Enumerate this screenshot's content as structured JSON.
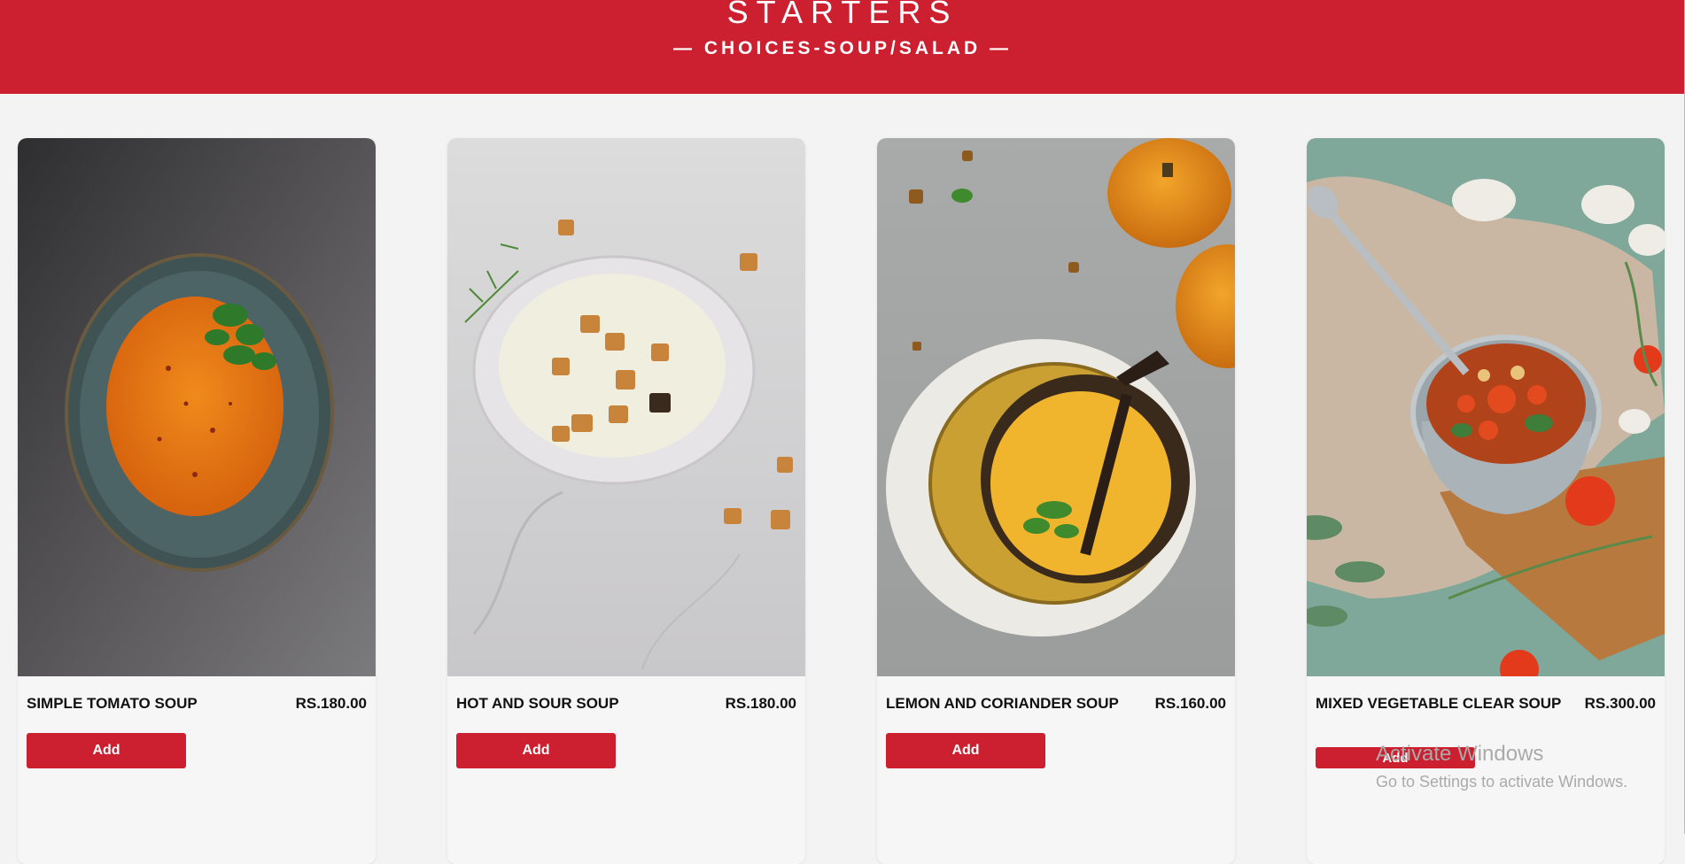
{
  "header": {
    "title": "STARTERS",
    "subtitle": "— CHOICES-SOUP/SALAD —"
  },
  "colors": {
    "brand_red": "#cc1f2f",
    "page_bg": "#f3f3f3",
    "card_bg": "#f6f6f6"
  },
  "items": [
    {
      "name": "SIMPLE TOMATO SOUP",
      "price": "RS.180.00",
      "add_label": "Add"
    },
    {
      "name": "HOT AND SOUR SOUP",
      "price": "RS.180.00",
      "add_label": "Add"
    },
    {
      "name": "LEMON AND CORIANDER SOUP",
      "price": "RS.160.00",
      "add_label": "Add"
    },
    {
      "name": "MIXED VEGETABLE CLEAR SOUP",
      "price": "RS.300.00",
      "add_label": "Add"
    }
  ],
  "os_overlay": {
    "line1": "Activate Windows",
    "line2": "Go to Settings to activate Windows."
  }
}
